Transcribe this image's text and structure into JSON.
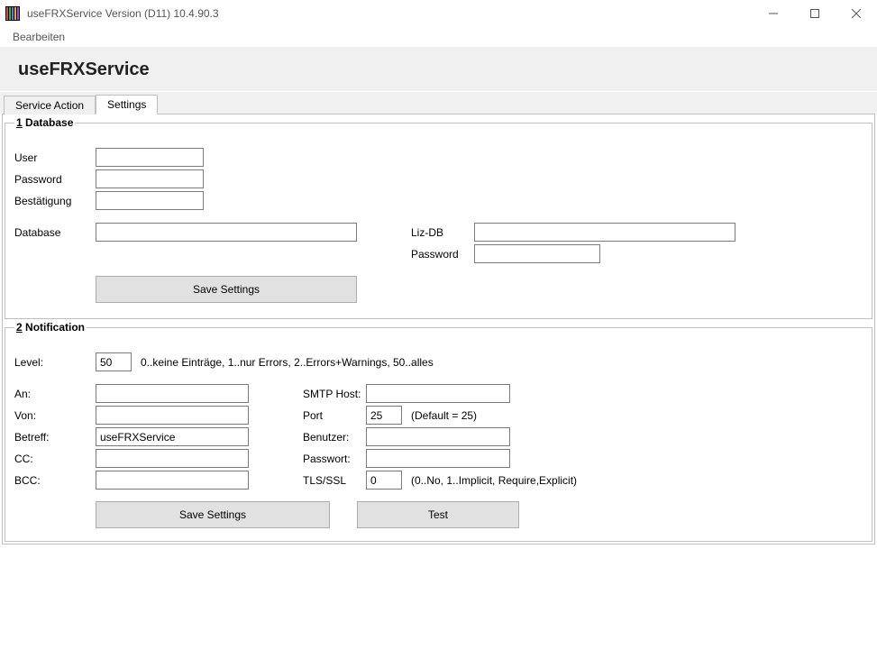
{
  "window": {
    "title": "useFRXService Version (D11) 10.4.90.3"
  },
  "menu": {
    "edit": "Bearbeiten"
  },
  "header": {
    "title": "useFRXService"
  },
  "tabs": {
    "service_action": "Service Action",
    "settings": "Settings"
  },
  "database": {
    "legend_num": "1",
    "legend_text": " Database",
    "user_label": "User",
    "user_value": "",
    "password_label": "Password",
    "password_value": "",
    "confirm_label": "Bestätigung",
    "confirm_value": "",
    "database_label": "Database",
    "database_value": "",
    "lizdb_label": "Liz-DB",
    "lizdb_value": "",
    "lizpw_label": "Password",
    "lizpw_value": "",
    "save_label": "Save Settings"
  },
  "notification": {
    "legend_num": "2",
    "legend_text": " Notification",
    "level_label": "Level:",
    "level_value": "50",
    "level_hint": "0..keine Einträge, 1..nur Errors, 2..Errors+Warnings, 50..alles",
    "an_label": "An:",
    "an_value": "",
    "von_label": "Von:",
    "von_value": "",
    "betreff_label": "Betreff:",
    "betreff_value": "useFRXService",
    "cc_label": "CC:",
    "cc_value": "",
    "bcc_label": "BCC:",
    "bcc_value": "",
    "smtp_label": "SMTP Host:",
    "smtp_value": "",
    "port_label": "Port",
    "port_value": "25",
    "port_hint": "(Default = 25)",
    "benutzer_label": "Benutzer:",
    "benutzer_value": "",
    "passwort_label": "Passwort:",
    "passwort_value": "",
    "tls_label": "TLS/SSL",
    "tls_value": "0",
    "tls_hint": "(0..No, 1..Implicit, Require,Explicit)",
    "save_label": "Save Settings",
    "test_label": "Test"
  }
}
